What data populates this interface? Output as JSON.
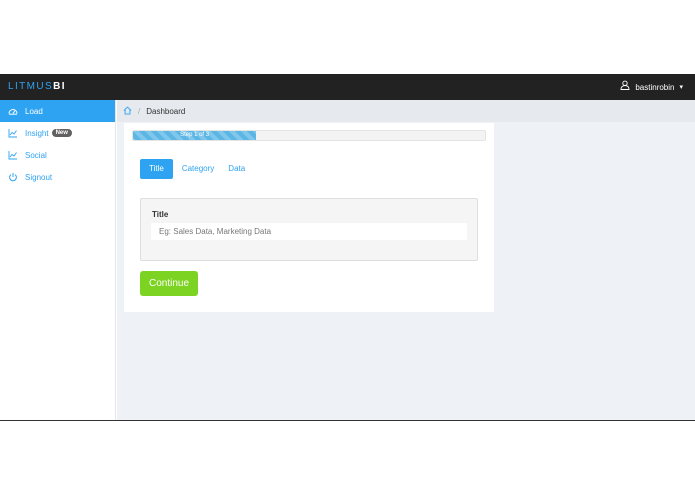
{
  "brand": {
    "part1": "LITMUS",
    "part2": "BI"
  },
  "user": {
    "name": "bastinrobin",
    "icon": "user-icon",
    "caret": "▾"
  },
  "sidebar": {
    "items": [
      {
        "label": "Load",
        "icon": "dashboard-icon",
        "active": true
      },
      {
        "label": "Insight",
        "icon": "chart-icon",
        "badge": "New"
      },
      {
        "label": "Social",
        "icon": "chart-icon"
      },
      {
        "label": "Signout",
        "icon": "power-icon"
      }
    ]
  },
  "breadcrumb": {
    "icon": "home-icon",
    "separator": "/",
    "current": "Dashboard"
  },
  "wizard": {
    "progress": {
      "label": "Step 1 of 3",
      "fraction": 0.35
    },
    "tabs": [
      "Title",
      "Category",
      "Data"
    ],
    "active_tab": "Title",
    "form": {
      "label": "Title",
      "value": "",
      "placeholder": "Eg: Sales Data, Marketing Data"
    },
    "continue_label": "Continue"
  },
  "colors": {
    "accent": "#2ea3f2",
    "topbar": "#222222",
    "continue": "#7dd321",
    "badge": "#616161"
  }
}
